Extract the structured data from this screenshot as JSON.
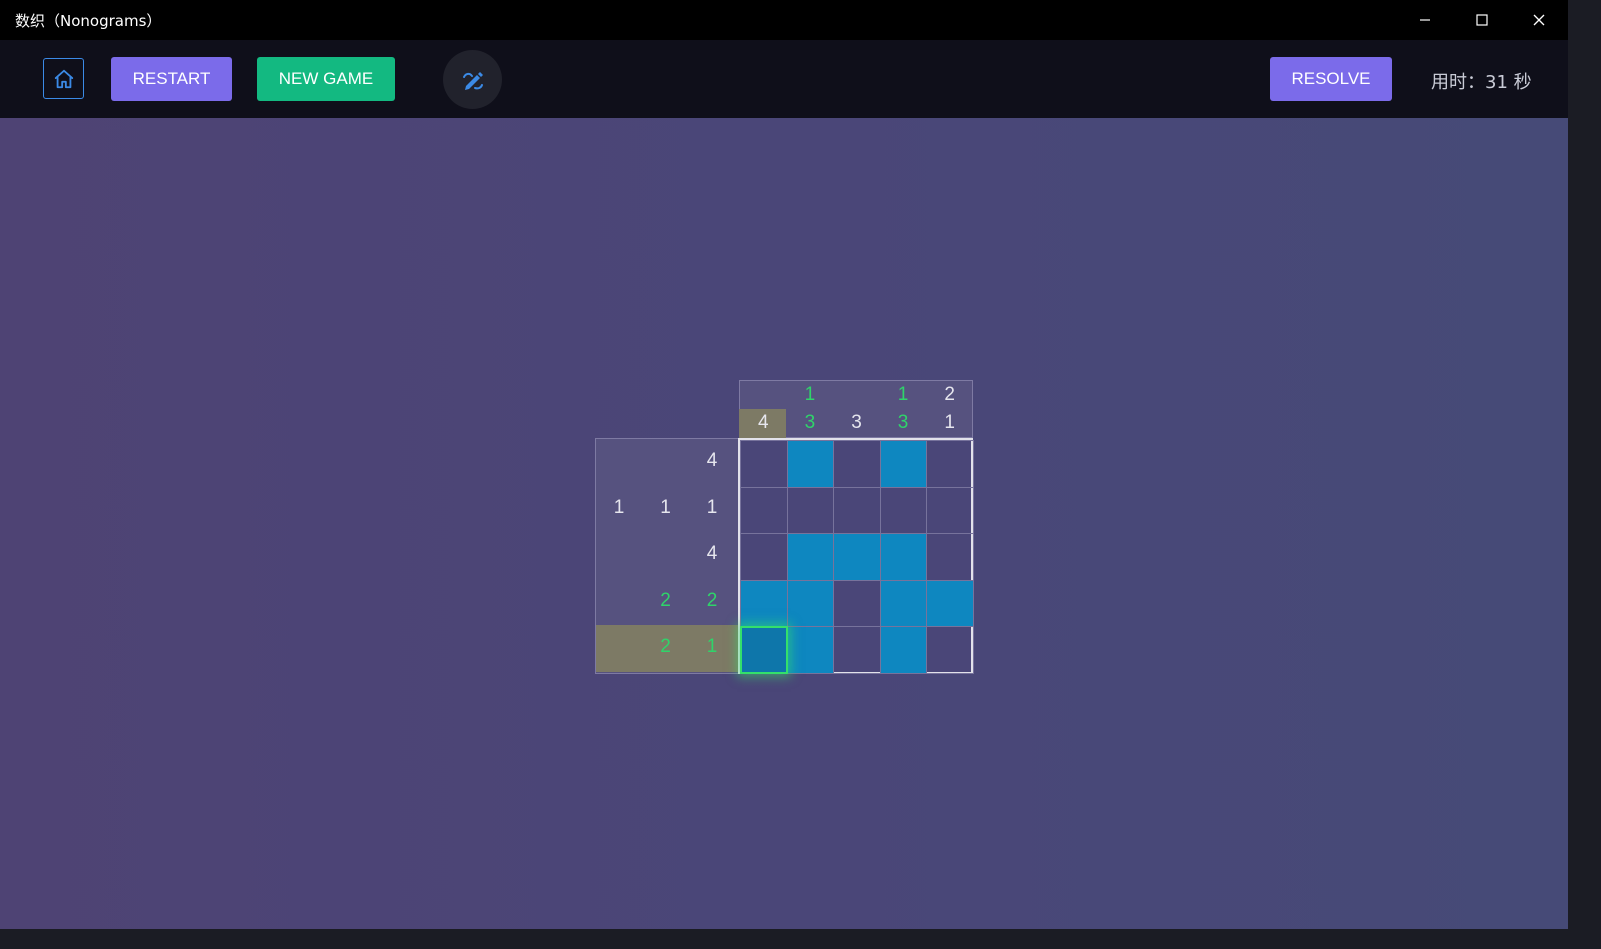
{
  "window": {
    "title": "数织（Nonograms）",
    "controls": [
      "minimize-icon",
      "maximize-icon",
      "close-icon"
    ]
  },
  "toolbar": {
    "home_icon": "home-icon",
    "restart_label": "RESTART",
    "new_game_label": "NEW GAME",
    "edit_icon": "pencil-edit-icon",
    "resolve_label": "RESOLVE",
    "timer_label": "用时：",
    "timer_value": "31",
    "timer_unit": "秒"
  },
  "colors": {
    "accent_purple": "#7b6bea",
    "accent_green": "#13b981",
    "filled_cell": "#0e87c0",
    "hint_satisfied": "#2fd46a",
    "hint_highlight": "#7d7a65"
  },
  "puzzle": {
    "size": 5,
    "column_hints": [
      [
        {
          "v": "4",
          "ok": false
        }
      ],
      [
        {
          "v": "1",
          "ok": true
        },
        {
          "v": "3",
          "ok": true
        }
      ],
      [
        {
          "v": "3",
          "ok": false
        }
      ],
      [
        {
          "v": "1",
          "ok": true
        },
        {
          "v": "3",
          "ok": true
        }
      ],
      [
        {
          "v": "2",
          "ok": false
        },
        {
          "v": "1",
          "ok": false
        }
      ]
    ],
    "row_hints": [
      [
        {
          "v": "4",
          "ok": false
        }
      ],
      [
        {
          "v": "1",
          "ok": false
        },
        {
          "v": "1",
          "ok": false
        },
        {
          "v": "1",
          "ok": false
        }
      ],
      [
        {
          "v": "4",
          "ok": false
        }
      ],
      [
        {
          "v": "2",
          "ok": true
        },
        {
          "v": "2",
          "ok": true
        }
      ],
      [
        {
          "v": "2",
          "ok": true
        },
        {
          "v": "1",
          "ok": true
        }
      ]
    ],
    "cells": [
      [
        0,
        1,
        0,
        1,
        0
      ],
      [
        0,
        0,
        0,
        0,
        0
      ],
      [
        0,
        1,
        1,
        1,
        0
      ],
      [
        1,
        1,
        0,
        1,
        1
      ],
      [
        1,
        1,
        0,
        1,
        0
      ]
    ],
    "active_cell": {
      "row": 4,
      "col": 0
    },
    "highlighted_row": 4,
    "highlighted_col": 0
  }
}
